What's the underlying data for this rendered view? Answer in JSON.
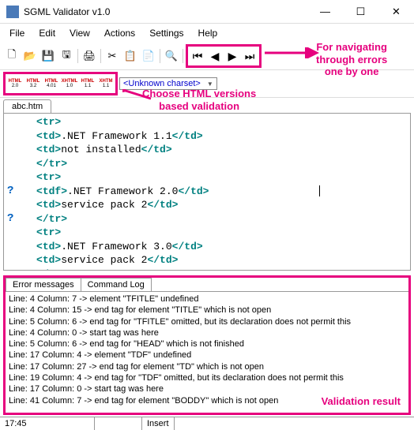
{
  "title": "SGML Validator v1.0",
  "menu": [
    "File",
    "Edit",
    "View",
    "Actions",
    "Settings",
    "Help"
  ],
  "versions": [
    {
      "t": "HTML",
      "v": "2.0"
    },
    {
      "t": "HTML",
      "v": "3.2"
    },
    {
      "t": "HTML",
      "v": "4.01"
    },
    {
      "t": "XHTML",
      "v": "1.0"
    },
    {
      "t": "HTML",
      "v": "1.1"
    },
    {
      "t": "XHTM",
      "v": "1.1"
    }
  ],
  "charset": "<Unknown charset>",
  "annot_nav": "For navigating\nthrough errors\none by one",
  "annot_ver": "Choose HTML versions\nbased validation",
  "annot_result": "Validation result",
  "tab_file": "abc.htm",
  "code": [
    {
      "g": "",
      "raw": "  <tr>"
    },
    {
      "g": "",
      "raw": "  <td>.NET Framework 1.1</td>"
    },
    {
      "g": "",
      "raw": "  <td>not installed</td>"
    },
    {
      "g": "",
      "raw": "  </tr>"
    },
    {
      "g": "",
      "raw": "  <tr>"
    },
    {
      "g": "?",
      "raw": "  <tdf>.NET Framework 2.0</td>",
      "cursor": true
    },
    {
      "g": "",
      "raw": "  <td>service pack 2</td>"
    },
    {
      "g": "?",
      "raw": "  </tr>"
    },
    {
      "g": "",
      "raw": "  <tr>"
    },
    {
      "g": "",
      "raw": "  <td>.NET Framework 3.0</td>"
    },
    {
      "g": "",
      "raw": "  <td>service pack 2</td>"
    },
    {
      "g": "",
      "raw": "  </tr>"
    }
  ],
  "bottom_tabs": [
    "Error messages",
    "Command Log"
  ],
  "errors": [
    "Line: 4 Column: 7 -> element \"TFITLE\" undefined",
    "Line: 4 Column: 15 -> end tag for element \"TITLE\" which is not open",
    "Line: 5 Column: 6 -> end tag for \"TFITLE\" omitted, but its declaration does not permit this",
    "Line: 4 Column: 0 -> start tag was here",
    "Line: 5 Column: 6 -> end tag for \"HEAD\" which is not finished",
    "Line: 17 Column: 4 -> element \"TDF\" undefined",
    "Line: 17 Column: 27 -> end tag for element \"TD\" which is not open",
    "Line: 19 Column: 4 -> end tag for \"TDF\" omitted, but its declaration does not permit this",
    "Line: 17 Column: 0 -> start tag was here",
    "Line: 41 Column: 7 -> end tag for element \"BODDY\" which is not open"
  ],
  "status": {
    "time": "17:45",
    "mode": "Insert"
  }
}
